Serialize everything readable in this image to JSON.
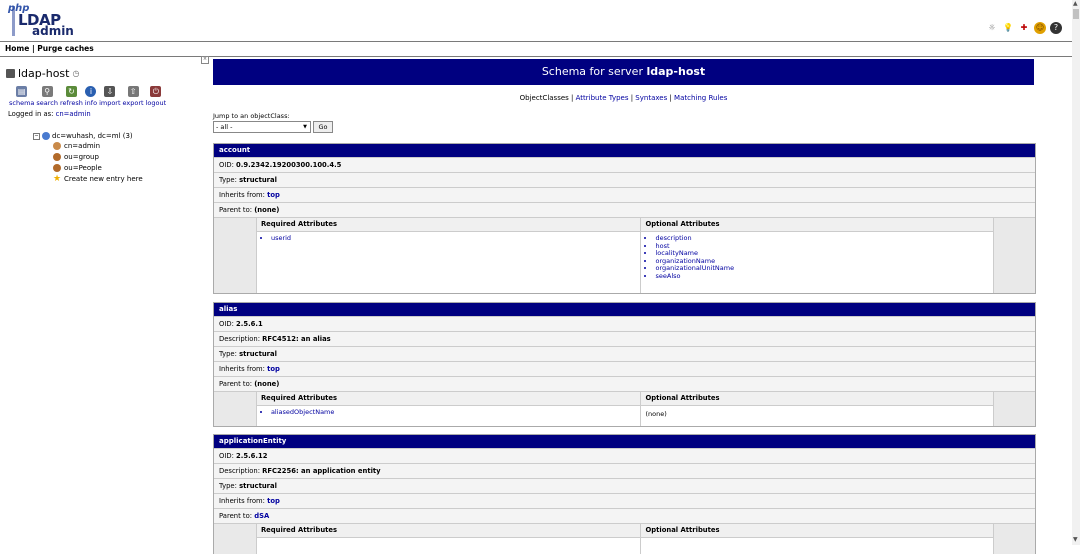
{
  "header": {
    "logo": {
      "php": "php",
      "ldap": "LDAP",
      "admin": "admin"
    },
    "top_icons": [
      "bug-icon",
      "lightbulb-icon",
      "wrench-icon",
      "smiley-icon",
      "help-icon"
    ]
  },
  "links": {
    "text": "Home | Purge caches"
  },
  "left": {
    "host": "ldap-host",
    "tools": [
      {
        "label": "schema",
        "icon": "schema-icon",
        "color": "#6b7ea6"
      },
      {
        "label": "search",
        "icon": "search-icon",
        "color": "#7a7a7a"
      },
      {
        "label": "refresh",
        "icon": "refresh-icon",
        "color": "#5b8b3a"
      },
      {
        "label": "info",
        "icon": "info-icon",
        "color": "#2a5fb0"
      },
      {
        "label": "import",
        "icon": "import-icon",
        "color": "#555"
      },
      {
        "label": "export",
        "icon": "export-icon",
        "color": "#777"
      },
      {
        "label": "logout",
        "icon": "logout-icon",
        "color": "#8b3a3a"
      }
    ],
    "logged_in_prefix": "Logged in as: ",
    "logged_in_user": "cn=admin",
    "tree": {
      "root": "dc=wuhash, dc=ml (3)",
      "children": [
        {
          "label": "cn=admin",
          "icon": "user-icon",
          "color": "#c98a4a"
        },
        {
          "label": "ou=group",
          "icon": "group-icon",
          "color": "#b26a2a"
        },
        {
          "label": "ou=People",
          "icon": "people-icon",
          "color": "#b26a2a"
        },
        {
          "label": "Create new entry here",
          "icon": "star-icon",
          "color": "#f0b000"
        }
      ]
    }
  },
  "main": {
    "title_prefix": "Schema for server ",
    "title_host": "ldap-host",
    "subnav": [
      "ObjectClasses",
      "Attribute Types",
      "Syntaxes",
      "Matching Rules"
    ],
    "jump_label": "Jump to an objectClass:",
    "jump_value": "- all -",
    "go_label": "Go",
    "labels": {
      "oid": "OID: ",
      "description": "Description: ",
      "type": "Type: ",
      "inherits": "Inherits from: ",
      "parent": "Parent to: ",
      "required": "Required Attributes",
      "optional": "Optional Attributes"
    },
    "classes": [
      {
        "name": "account",
        "oid": "0.9.2342.19200300.100.4.5",
        "type": "structural",
        "inherits": "top",
        "parent": "(none)",
        "required": [
          "userid"
        ],
        "optional": [
          "description",
          "host",
          "localityName",
          "organizationName",
          "organizationalUnitName",
          "seeAlso"
        ]
      },
      {
        "name": "alias",
        "oid": "2.5.6.1",
        "description": "RFC4512: an alias",
        "type": "structural",
        "inherits": "top",
        "parent": "(none)",
        "required": [
          "aliasedObjectName"
        ],
        "optional_none": "(none)"
      },
      {
        "name": "applicationEntity",
        "oid": "2.5.6.12",
        "description": "RFC2256: an application entity",
        "type": "structural",
        "inherits": "top",
        "parent": "dSA"
      }
    ]
  }
}
